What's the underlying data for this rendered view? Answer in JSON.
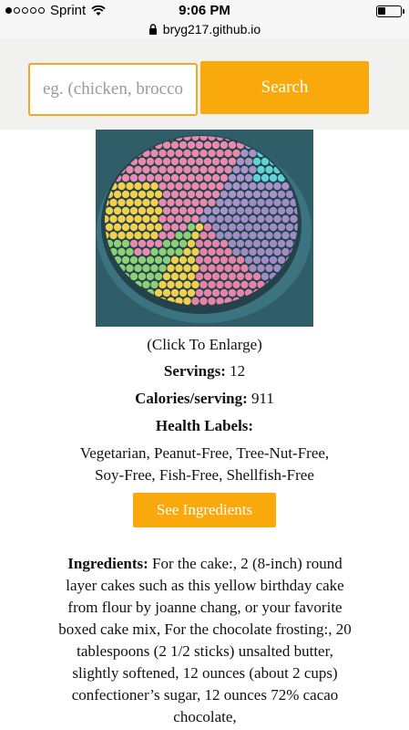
{
  "status_bar": {
    "carrier": "Sprint",
    "time": "9:06 PM",
    "signal_dots": 5,
    "signal_full": 1
  },
  "browser": {
    "url": "bryg217.github.io"
  },
  "search": {
    "placeholder": "eg. (chicken, broccoli)",
    "button_label": "Search"
  },
  "recipe": {
    "enlarge_label": "(Click To Enlarge)",
    "servings_label": "Servings:",
    "servings_value": "12",
    "calories_label": "Calories/serving:",
    "calories_value": "911",
    "health_labels_heading": "Health Labels:",
    "health_labels_line1": "Vegetarian, Peanut-Free, Tree-Nut-Free,",
    "health_labels_line2": "Soy-Free, Fish-Free, Shellfish-Free",
    "see_ingredients_label": "See Ingredients",
    "ingredients_label": "Ingredients:",
    "ingredients_text": " For the cake:, 2 (8-inch) round layer cakes such as this yellow birthday cake from flour by joanne chang, or your favorite boxed cake mix, For the chocolate frosting:, 20 tablespoons (2 1/2 sticks) unsalted butter, slightly softened, 12 ounces (about 2 cups) confectioner’s sugar, 12 ounces 72% cacao chocolate,"
  },
  "colors": {
    "accent": "#f9a90b",
    "header_bg": "#f1f1ef",
    "image_bg": "#2f5e68"
  }
}
